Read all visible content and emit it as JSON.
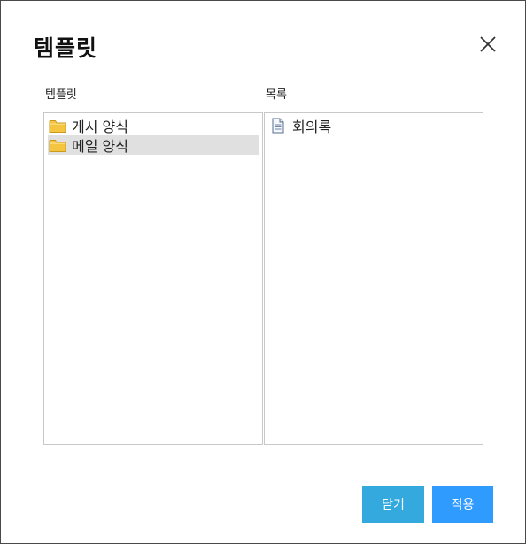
{
  "dialog": {
    "title": "템플릿",
    "close_icon": "close-icon"
  },
  "left_panel": {
    "label": "템플릿",
    "items": [
      {
        "label": "게시 양식",
        "icon": "folder-icon",
        "selected": false
      },
      {
        "label": "메일 양식",
        "icon": "folder-icon",
        "selected": true
      }
    ]
  },
  "right_panel": {
    "label": "목록",
    "items": [
      {
        "label": "회의록",
        "icon": "document-icon"
      }
    ]
  },
  "buttons": {
    "close_label": "닫기",
    "apply_label": "적용"
  },
  "colors": {
    "close_button": "#33a9de",
    "apply_button": "#2f9bff",
    "selected_row": "#e0e0e0",
    "folder": "#f5c542"
  }
}
